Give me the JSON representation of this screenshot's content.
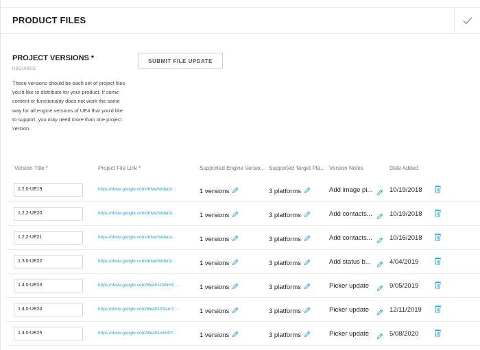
{
  "header": {
    "title": "PRODUCT FILES",
    "confirm_icon": "check-icon"
  },
  "versions_section": {
    "title": "PROJECT VERSIONS *",
    "required_label": "REQUIRED",
    "description": "These versions should be each set of project files you'd like to distribute for your product. If some content or functionality does not work the same way for all engine versions of UE4 that you'd like to support, you may need more than one project version.",
    "submit_label": "SUBMIT FILE UPDATE"
  },
  "table": {
    "headers": {
      "version_title": "Version Title *",
      "file_link": "Project File Link *",
      "engine": "Supported Engine Versio...",
      "platforms": "Supported Target Pla...",
      "notes": "Version Notes",
      "date": "Date Added"
    },
    "rows": [
      {
        "version": "1.2.0-UE19",
        "link": "https://drive.google.com/drive/folders/...",
        "engine": "1 versions",
        "platforms": "3 platforms",
        "notes": "Add image pi...",
        "date": "10/19/2018"
      },
      {
        "version": "1.2.2-UE20",
        "link": "https://drive.google.com/drive/folders/...",
        "engine": "1 versions",
        "platforms": "3 platforms",
        "notes": "Add contacts...",
        "date": "10/19/2018"
      },
      {
        "version": "1.2.2-UE21",
        "link": "https://drive.google.com/drive/folders/...",
        "engine": "1 versions",
        "platforms": "3 platforms",
        "notes": "Add contacts...",
        "date": "10/16/2018"
      },
      {
        "version": "1.3.0-UE22",
        "link": "https://drive.google.com/drive/folders/...",
        "engine": "1 versions",
        "platforms": "3 platforms",
        "notes": "Add status b...",
        "date": "4/04/2019"
      },
      {
        "version": "1.4.0-UE23",
        "link": "https://drive.google.com/file/d/1DvNH2...",
        "engine": "1 versions",
        "platforms": "3 platforms",
        "notes": "Picker update",
        "date": "9/05/2019"
      },
      {
        "version": "1.4.0-UE24",
        "link": "https://drive.google.com/file/d/10Sam7...",
        "engine": "1 versions",
        "platforms": "3 platforms",
        "notes": "Picker update",
        "date": "12/11/2019"
      },
      {
        "version": "1.4.0-UE25",
        "link": "https://drive.google.com/file/d/1v3XP7...",
        "engine": "1 versions",
        "platforms": "3 platforms",
        "notes": "Picker update",
        "date": "5/08/2020"
      }
    ]
  },
  "colors": {
    "link": "#1a9fd8",
    "icon": "#2aaee6",
    "header_text": "#1f1f1f",
    "muted": "#777777"
  },
  "icons": {
    "edit": "pencil-icon",
    "delete": "trash-icon"
  }
}
